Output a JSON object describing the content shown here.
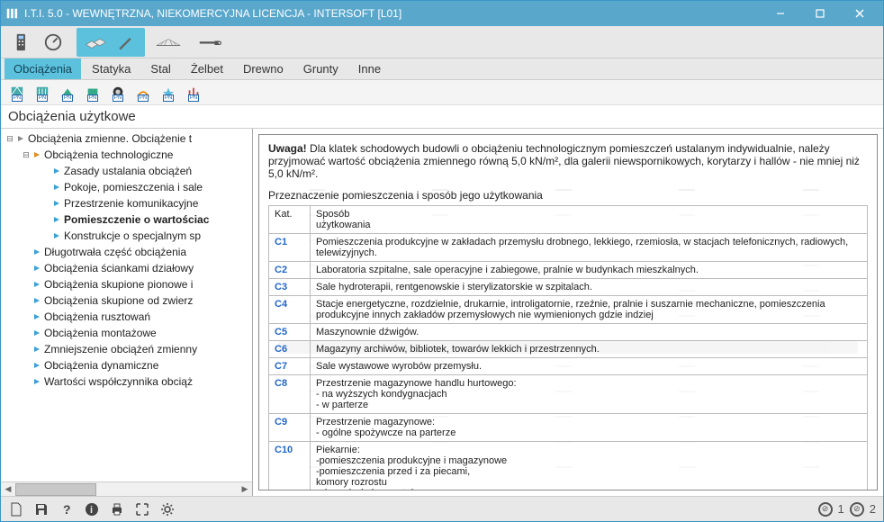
{
  "window": {
    "title": "I.T.I. 5.0 - WEWNĘTRZNA, NIEKOMERCYJNA LICENCJA - INTERSOFT [L01]"
  },
  "menu_tabs": [
    "Obciążenia",
    "Statyka",
    "Stal",
    "Żelbet",
    "Drewno",
    "Grunty",
    "Inne"
  ],
  "active_tab": "Obciążenia",
  "section_title": "Obciążenia użytkowe",
  "tree": [
    {
      "lvl": 0,
      "exp": "-",
      "kind": "root",
      "label": "Obciążenia zmienne. Obciążenie t"
    },
    {
      "lvl": 1,
      "exp": "-",
      "kind": "open",
      "label": "Obciążenia technologiczne"
    },
    {
      "lvl": 2,
      "exp": "",
      "kind": "leaf",
      "label": "Zasady ustalania obciążeń"
    },
    {
      "lvl": 2,
      "exp": "",
      "kind": "leaf",
      "label": "Pokoje, pomieszczenia i sale"
    },
    {
      "lvl": 2,
      "exp": "",
      "kind": "leaf",
      "label": "Przestrzenie komunikacyjne"
    },
    {
      "lvl": 2,
      "exp": "",
      "kind": "leaf",
      "label": "Pomieszczenie o wartościac",
      "sel": true
    },
    {
      "lvl": 2,
      "exp": "",
      "kind": "leaf",
      "label": "Konstrukcje o specjalnym sp"
    },
    {
      "lvl": 1,
      "exp": "",
      "kind": "node",
      "label": "Długotrwała część obciążenia"
    },
    {
      "lvl": 1,
      "exp": "",
      "kind": "node",
      "label": "Obciążenia ściankami działowy"
    },
    {
      "lvl": 1,
      "exp": "",
      "kind": "node",
      "label": "Obciążenia skupione pionowe i"
    },
    {
      "lvl": 1,
      "exp": "",
      "kind": "node",
      "label": "Obciążenia skupione od zwierz"
    },
    {
      "lvl": 1,
      "exp": "",
      "kind": "node",
      "label": "Obciążenia rusztowań"
    },
    {
      "lvl": 1,
      "exp": "",
      "kind": "node",
      "label": "Obciążenia montażowe"
    },
    {
      "lvl": 1,
      "exp": "",
      "kind": "node",
      "label": "Zmniejszenie obciążeń zmienny"
    },
    {
      "lvl": 1,
      "exp": "",
      "kind": "node",
      "label": "Obciążenia dynamiczne"
    },
    {
      "lvl": 1,
      "exp": "",
      "kind": "node",
      "label": "Wartości współczynnika obciąż"
    }
  ],
  "detail": {
    "warning_label": "Uwaga!",
    "warning_html": "Dla klatek schodowych budowli o obciążeniu technologicznym pomieszczeń ustalanym indywidualnie, należy przyjmować wartość obciążenia zmiennego równą 5,0 kN/m², dla galerii niewspornikowych, korytarzy i hallów - nie mniej niż 5,0 kN/m².",
    "tbl_heading": "Przeznaczenie pomieszczenia i sposób jego użytkowania",
    "th_kat": "Kat.",
    "th_sposob": "Sposób\nużytkowania",
    "rows": [
      {
        "kat": "C1",
        "desc": "Pomieszczenia produkcyjne w zakładach przemysłu drobnego, lekkiego, rzemiosła, w stacjach telefonicznych, radiowych, telewizyjnych."
      },
      {
        "kat": "C2",
        "desc": "Laboratoria szpitalne, sale operacyjne i zabiegowe, pralnie w budynkach mieszkalnych."
      },
      {
        "kat": "C3",
        "desc": "Sale hydroterapii, rentgenowskie i sterylizatorskie w szpitalach."
      },
      {
        "kat": "C4",
        "desc": "Stacje energetyczne, rozdzielnie, drukarnie, introligatornie, rzeźnie, pralnie i suszarnie mechaniczne, pomieszczenia produkcyjne innych zakładów przemysłowych nie wymienionych gdzie indziej"
      },
      {
        "kat": "C5",
        "desc": "Maszynownie dźwigów."
      },
      {
        "kat": "C6",
        "desc": "Magazyny archiwów, bibliotek, towarów lekkich i przestrzennych."
      },
      {
        "kat": "C7",
        "desc": "Sale wystawowe wyrobów przemysłu."
      },
      {
        "kat": "C8",
        "desc": "Przestrzenie magazynowe handlu hurtowego:\n- na wyższych kondygnacjach\n- w parterze"
      },
      {
        "kat": "C9",
        "desc": "Przestrzenie magazynowe:\n- ogólne spożywcze na parterze"
      },
      {
        "kat": "C10",
        "desc": "Piekarnie:\n-pomieszczenia produkcyjne i magazynowe\n-pomieszczenia przed i za piecami,\n komory rozrostu\n-ekspedycje i pozostałe."
      }
    ]
  },
  "status": {
    "right1": "1",
    "right2": "2"
  }
}
